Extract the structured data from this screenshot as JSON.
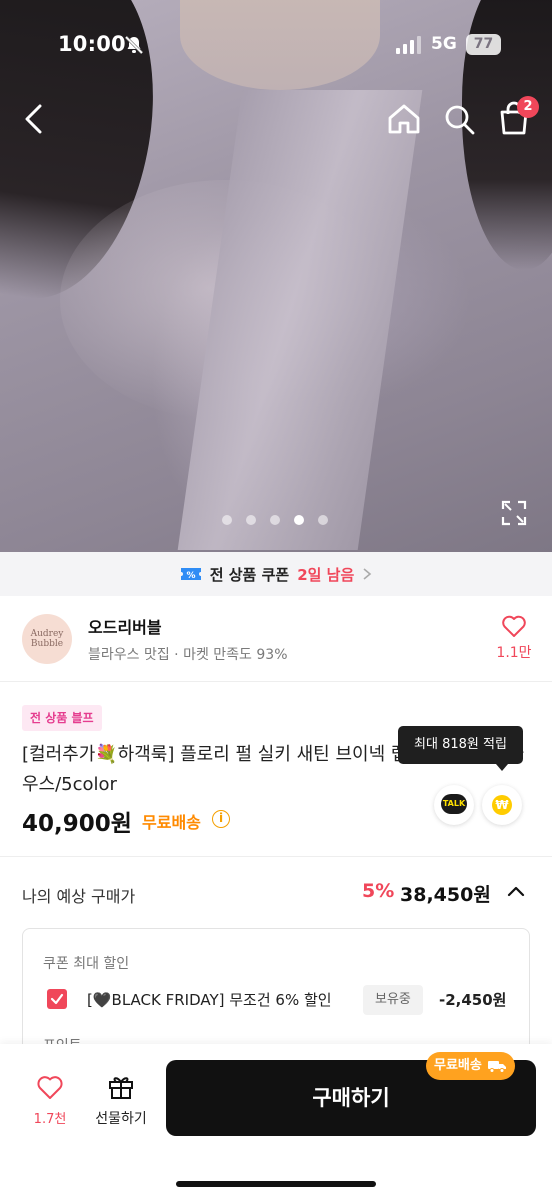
{
  "status_bar": {
    "time": "10:00",
    "network": "5G",
    "battery": "77"
  },
  "header": {
    "cart_count": "2"
  },
  "carousel": {
    "pages": 5,
    "active_index": 3
  },
  "coupon_banner": {
    "text": "전 상품 쿠폰",
    "highlight": "2일 남음"
  },
  "shop": {
    "logo_line1": "Audrey",
    "logo_line2": "Bubble",
    "name": "오드리버블",
    "tags": "블라우스 맛집 · 마켓 만족도 93%",
    "likes": "1.1만"
  },
  "product": {
    "badge": "전 상품 블프",
    "title": "[컬러추가💐하객룩] 플로리 펄 실키 새틴 브이넥 랩 셔링 타이 블라우스/5color",
    "price": "40,900원",
    "shipping": "무료배송",
    "talk_label": "TALK",
    "point_symbol": "₩",
    "tooltip": "최대 818원 적립"
  },
  "expected": {
    "label": "나의 예상 구매가",
    "discount": "5%",
    "price": "38,450원"
  },
  "coupon_box": {
    "heading": "쿠폰 최대 할인",
    "coupon_name": "[🖤BLACK FRIDAY] 무조건 6% 할인",
    "owned_label": "보유중",
    "amount": "-2,450원",
    "next_heading": "포인트"
  },
  "bottom_bar": {
    "like_count": "1.7천",
    "gift_label": "선물하기",
    "buy_label": "구매하기",
    "free_shipping_badge": "무료배송"
  },
  "colors": {
    "accent_red": "#f0475a",
    "orange": "#ff8a00",
    "buy_button": "#111111",
    "badge_pink": "#e53d8f"
  }
}
